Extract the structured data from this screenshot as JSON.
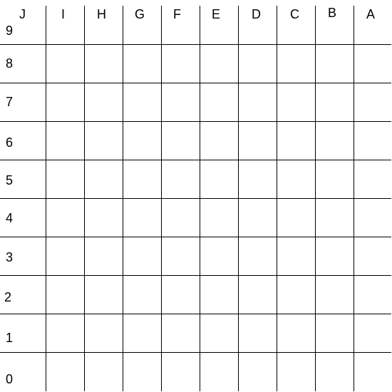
{
  "column_labels": [
    "J",
    "I",
    "H",
    "G",
    "F",
    "E",
    "D",
    "C",
    "B",
    "A"
  ],
  "row_labels": [
    "9",
    "8",
    "7",
    "6",
    "5",
    "4",
    "3",
    "2",
    "1",
    "0"
  ],
  "colors": {
    "background": "#ffffff",
    "lines": "#000000",
    "text": "#000000"
  }
}
